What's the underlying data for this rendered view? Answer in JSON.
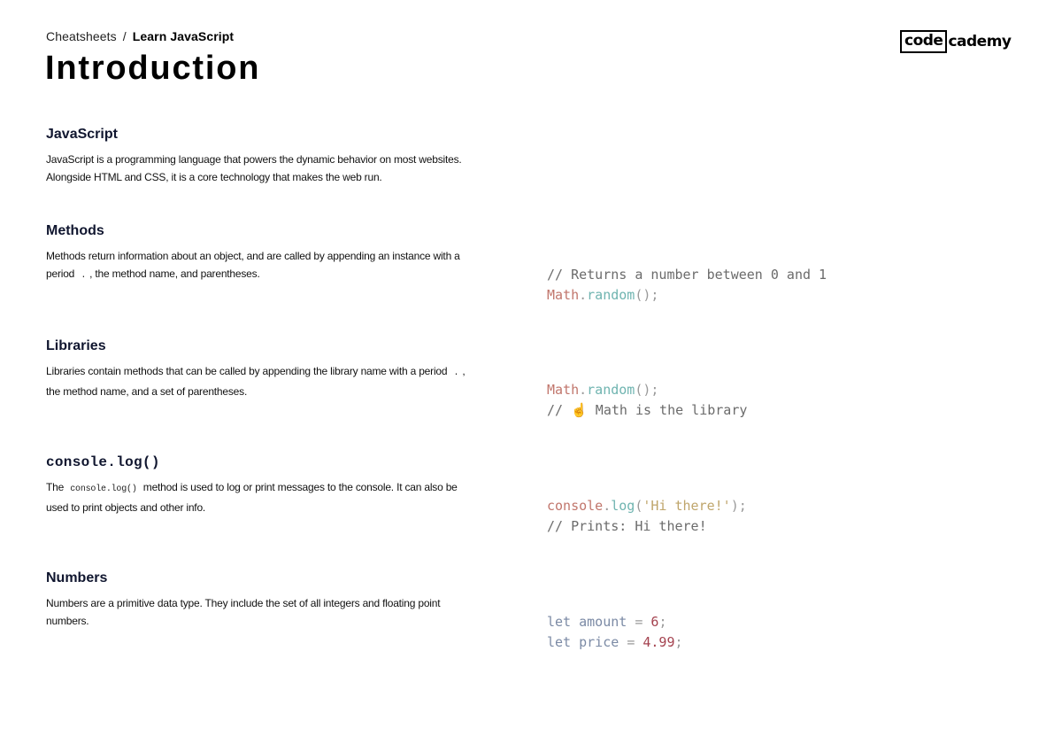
{
  "breadcrumb": {
    "root": "Cheatsheets",
    "separator": "/",
    "current": "Learn JavaScript"
  },
  "page_title": "Introduction",
  "logo": {
    "boxed": "code",
    "rest": "cademy"
  },
  "sections": [
    {
      "title": "JavaScript",
      "desc_parts": [
        "JavaScript is a programming language that powers the dynamic behavior on most websites. Alongside HTML and CSS, it is a core technology that makes the web run."
      ]
    },
    {
      "title": "Methods",
      "desc_before": "Methods return information about an object, and are called by appending an instance with a period",
      "desc_code": ".",
      "desc_after": ", the method name, and parentheses.",
      "code": {
        "line1": "// Returns a number between 0 and 1",
        "line2": {
          "obj": "Math",
          "dot": ".",
          "method": "random",
          "parens": "()",
          "end": ";"
        }
      }
    },
    {
      "title": "Libraries",
      "desc_before": "Libraries contain methods that can be called by appending the library name with a period",
      "desc_code": ".",
      "desc_after": ", the method name, and a set of parentheses.",
      "code": {
        "line1": {
          "obj": "Math",
          "dot": ".",
          "method": "random",
          "parens": "()",
          "end": ";"
        },
        "line2": "// ☝️ Math is the library"
      }
    },
    {
      "title": "console.log()",
      "desc_before": "The",
      "desc_code": "console.log()",
      "desc_after": "method is used to log or print messages to the console. It can also be used to print objects and other info.",
      "code": {
        "line1": {
          "obj": "console",
          "dot": ".",
          "method": "log",
          "open": "(",
          "string": "'Hi there!'",
          "close": ")",
          "end": ";"
        },
        "line2": "// Prints: Hi there!"
      }
    },
    {
      "title": "Numbers",
      "desc": "Numbers are a primitive data type. They include the set of all integers and floating point numbers.",
      "code": {
        "line1": {
          "kw": "let",
          "name": "amount",
          "op": "=",
          "value": "6",
          "end": ";"
        },
        "line2": {
          "kw": "let",
          "name": "price",
          "op": "=",
          "value": "4.99",
          "end": ";"
        }
      }
    }
  ]
}
